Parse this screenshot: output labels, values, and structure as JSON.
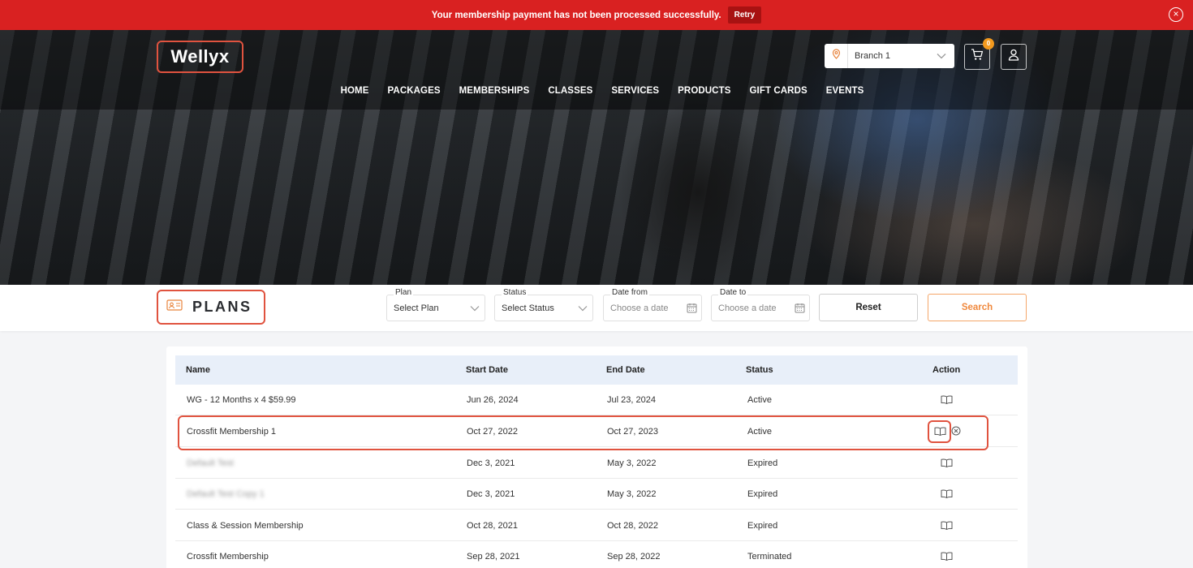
{
  "alert": {
    "message": "Your membership payment has not been processed successfully.",
    "retry_label": "Retry",
    "close_icon": "close-circle-icon",
    "color": "#d92121"
  },
  "header": {
    "logo": "Wellyx",
    "branch": {
      "label": "Branch 1",
      "icon": "location-pin-icon"
    },
    "cart": {
      "count": "0",
      "icon": "cart-icon"
    },
    "user_icon": "user-icon"
  },
  "nav": {
    "items": [
      "HOME",
      "PACKAGES",
      "MEMBERSHIPS",
      "CLASSES",
      "SERVICES",
      "PRODUCTS",
      "GIFT CARDS",
      "EVENTS"
    ]
  },
  "filters": {
    "title": "PLANS",
    "plan": {
      "label": "Plan",
      "value": "Select Plan"
    },
    "status": {
      "label": "Status",
      "value": "Select Status"
    },
    "date_from": {
      "label": "Date from",
      "placeholder": "Choose a date"
    },
    "date_to": {
      "label": "Date to",
      "placeholder": "Choose a date"
    },
    "reset_label": "Reset",
    "search_label": "Search",
    "accent": "#f0883c"
  },
  "table": {
    "columns": [
      "Name",
      "Start Date",
      "End Date",
      "Status",
      "Action"
    ],
    "rows": [
      {
        "name": "WG - 12 Months x 4 $59.99",
        "start": "Jun 26, 2024",
        "end": "Jul 23, 2024",
        "status": "Active"
      },
      {
        "name": "Crossfit Membership 1",
        "start": "Oct 27, 2022",
        "end": "Oct 27, 2023",
        "status": "Active"
      },
      {
        "name": "Default Test",
        "start": "Dec 3, 2021",
        "end": "May 3, 2022",
        "status": "Expired"
      },
      {
        "name": "Default Test Copy 1",
        "start": "Dec 3, 2021",
        "end": "May 3, 2022",
        "status": "Expired"
      },
      {
        "name": "Class & Session Membership",
        "start": "Oct 28, 2021",
        "end": "Oct 28, 2022",
        "status": "Expired"
      },
      {
        "name": "Crossfit Membership",
        "start": "Sep 28, 2021",
        "end": "Sep 28, 2022",
        "status": "Terminated"
      }
    ]
  },
  "highlight_color": "#e0533f"
}
